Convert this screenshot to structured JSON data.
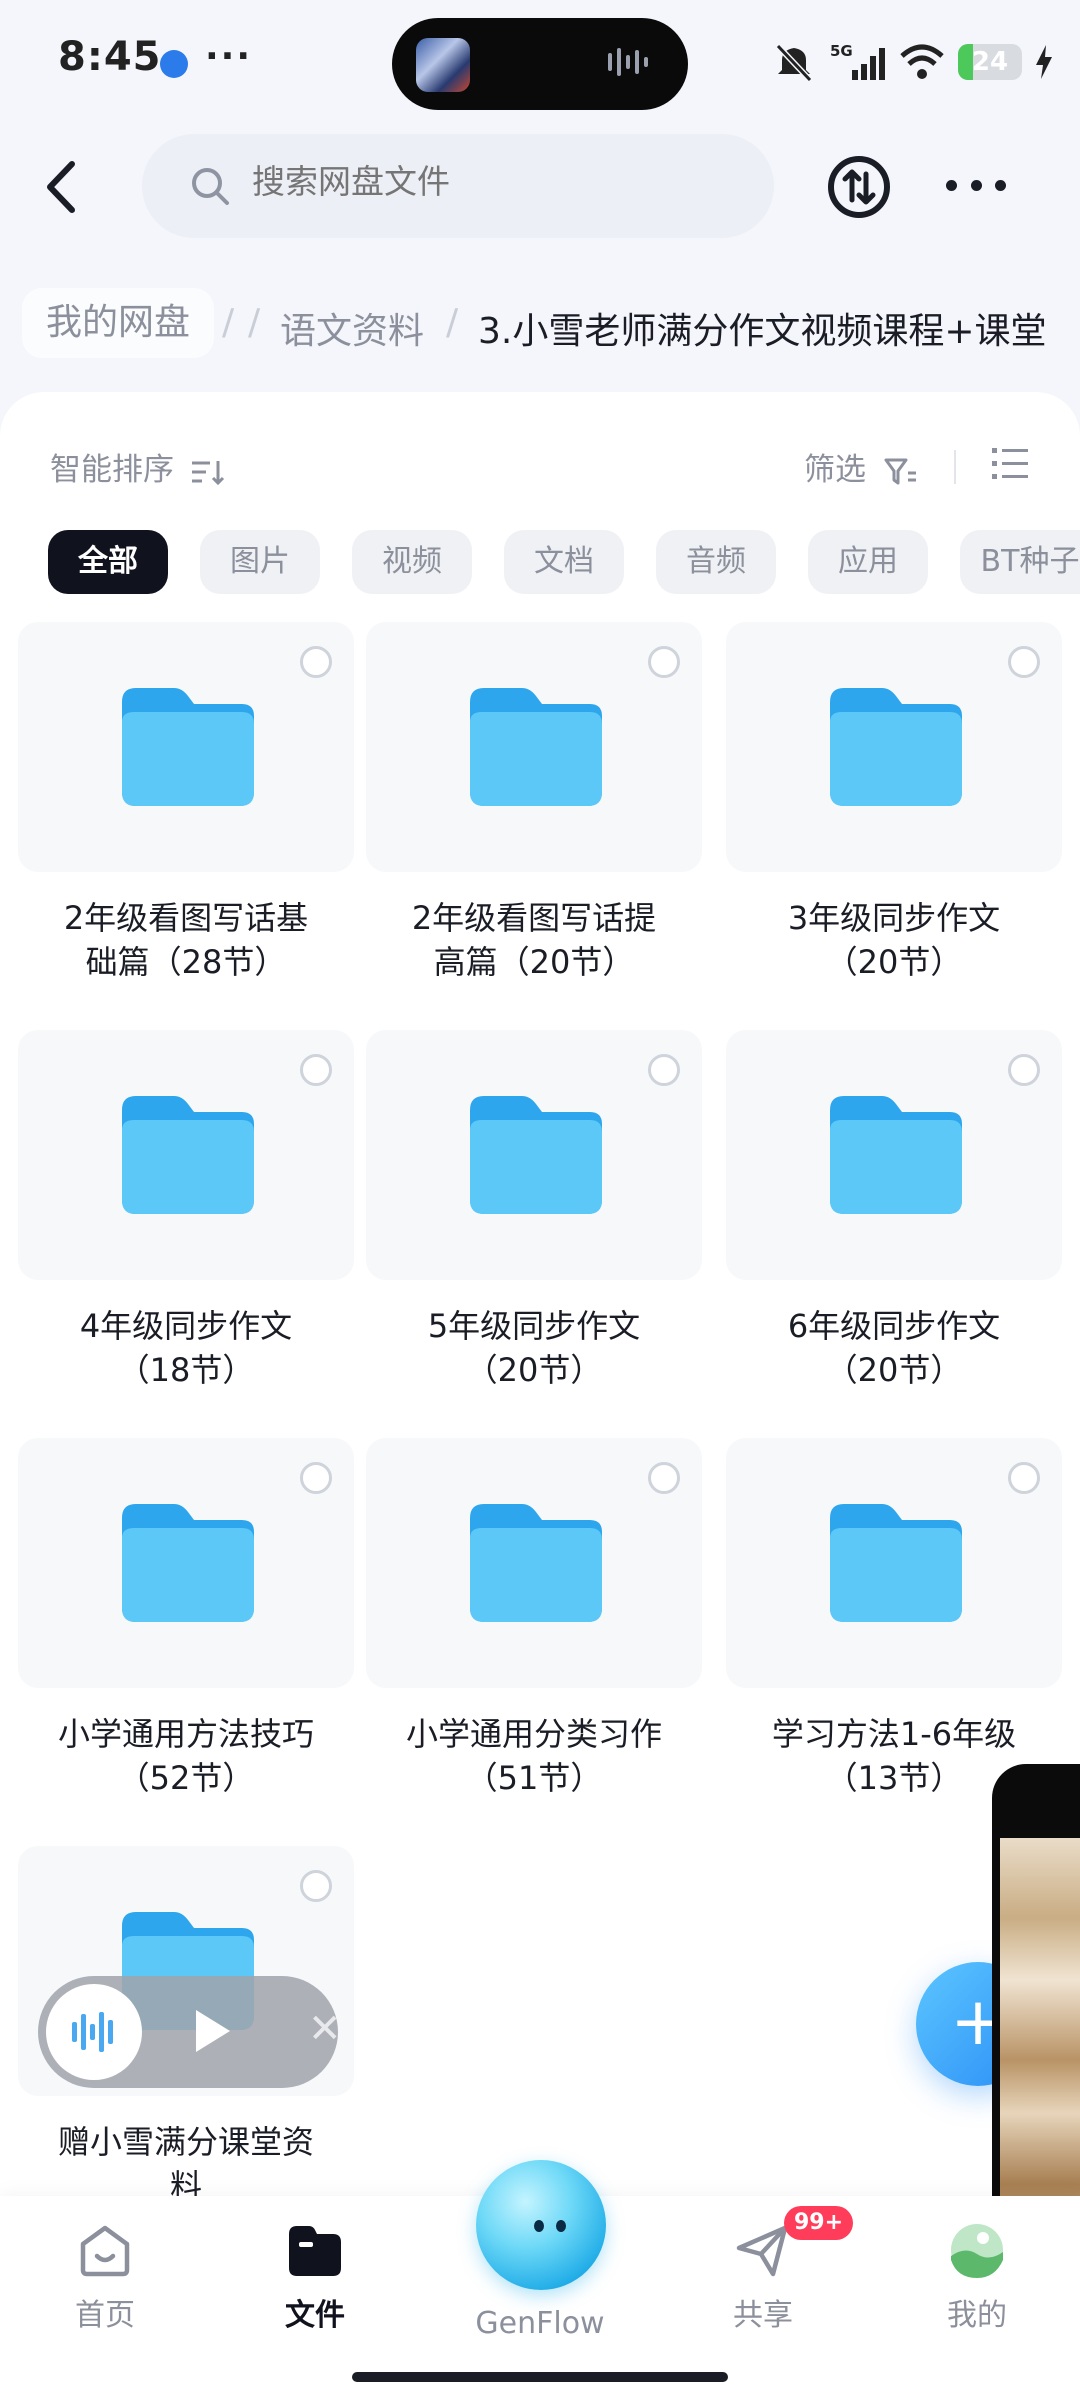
{
  "status_bar": {
    "time": "8:45",
    "network": "5G",
    "battery_percent": 24,
    "battery_label": "24"
  },
  "header": {
    "search_placeholder": "搜索网盘文件"
  },
  "breadcrumb": {
    "root": "我的网盘",
    "middle": "语文资料",
    "current": "3.小雪老师满分作文视频课程+课堂"
  },
  "toolbar": {
    "sort_label": "智能排序",
    "filter_label": "筛选"
  },
  "filter_chips": [
    "全部",
    "图片",
    "视频",
    "文档",
    "音频",
    "应用",
    "BT种子"
  ],
  "files": [
    {
      "line1": "2年级看图写话基",
      "line2": "础篇（28节）"
    },
    {
      "line1": "2年级看图写话提",
      "line2": "高篇（20节）"
    },
    {
      "line1": "3年级同步作文",
      "line2": "（20节）"
    },
    {
      "line1": "4年级同步作文",
      "line2": "（18节）"
    },
    {
      "line1": "5年级同步作文",
      "line2": "（20节）"
    },
    {
      "line1": "6年级同步作文",
      "line2": "（20节）"
    },
    {
      "line1": "小学通用方法技巧",
      "line2": "（52节）"
    },
    {
      "line1": "小学通用分类习作",
      "line2": "（51节）"
    },
    {
      "line1": "学习方法1-6年级",
      "line2": "（13节）"
    },
    {
      "line1": "赠小雪满分课堂资",
      "line2": "料"
    }
  ],
  "fab": {
    "label": "+"
  },
  "bottom_nav": {
    "home": "首页",
    "files": "文件",
    "genflow": "GenFlow",
    "share": "共享",
    "share_badge": "99+",
    "mine": "我的"
  },
  "colors": {
    "folder": "#45b8f5",
    "accent": "#2b8ef6",
    "active_chip": "#10121d",
    "badge": "#ff3d5a"
  }
}
